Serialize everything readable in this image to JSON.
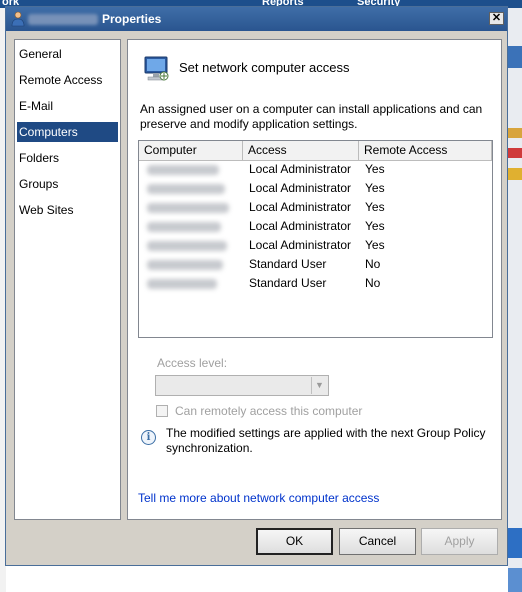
{
  "background": {
    "top_labels": [
      "ork",
      "Reports",
      "Security"
    ]
  },
  "window": {
    "title": "Properties",
    "close_label": "✕"
  },
  "nav": {
    "items": [
      {
        "label": "General",
        "selected": false
      },
      {
        "label": "Remote Access",
        "selected": false
      },
      {
        "label": "E-Mail",
        "selected": false
      },
      {
        "label": "Computers",
        "selected": true
      },
      {
        "label": "Folders",
        "selected": false
      },
      {
        "label": "Groups",
        "selected": false
      },
      {
        "label": "Web Sites",
        "selected": false
      }
    ]
  },
  "panel": {
    "title": "Set network computer access",
    "description": "An assigned user on a computer can install applications and can preserve and modify application settings.",
    "table": {
      "columns": [
        "Computer",
        "Access",
        "Remote Access"
      ],
      "rows": [
        {
          "computer": "",
          "access": "Local Administrator",
          "remote": "Yes"
        },
        {
          "computer": "",
          "access": "Local Administrator",
          "remote": "Yes"
        },
        {
          "computer": "",
          "access": "Local Administrator",
          "remote": "Yes"
        },
        {
          "computer": "",
          "access": "Local Administrator",
          "remote": "Yes"
        },
        {
          "computer": "",
          "access": "Local Administrator",
          "remote": "Yes"
        },
        {
          "computer": "",
          "access": "Standard User",
          "remote": "No"
        },
        {
          "computer": "",
          "access": "Standard User",
          "remote": "No"
        }
      ]
    },
    "access_level_label": "Access level:",
    "access_level_value": "",
    "remote_checkbox_label": "Can remotely access this computer",
    "remote_checkbox_checked": false,
    "info_text": "The modified settings are applied with the next Group Policy synchronization.",
    "link_text": "Tell me more about network computer access"
  },
  "buttons": {
    "ok": "OK",
    "cancel": "Cancel",
    "apply": "Apply"
  },
  "colors": {
    "titlebar": "#2a5590",
    "selection": "#1f4a84",
    "link": "#0033cc",
    "dialog_bg": "#d4d0c8"
  }
}
